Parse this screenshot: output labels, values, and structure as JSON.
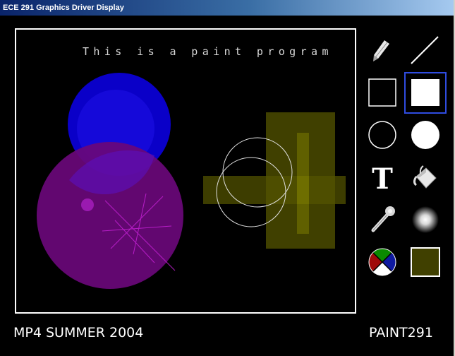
{
  "window": {
    "title": "ECE 291 Graphics Driver Display"
  },
  "canvas": {
    "banner_text": "This is a paint program"
  },
  "toolbar": {
    "tools": [
      {
        "name": "pencil-tool",
        "icon": "pencil-icon"
      },
      {
        "name": "line-tool",
        "icon": "line-icon"
      },
      {
        "name": "rectangle-outline-tool",
        "icon": "rectangle-outline-icon"
      },
      {
        "name": "rectangle-filled-tool",
        "icon": "rectangle-filled-icon",
        "selected": true
      },
      {
        "name": "circle-outline-tool",
        "icon": "circle-outline-icon"
      },
      {
        "name": "circle-filled-tool",
        "icon": "circle-filled-icon"
      },
      {
        "name": "text-tool",
        "icon": "text-icon",
        "glyph": "T"
      },
      {
        "name": "fill-bucket-tool",
        "icon": "paint-bucket-icon"
      },
      {
        "name": "eyedropper-tool",
        "icon": "eyedropper-icon"
      },
      {
        "name": "airbrush-tool",
        "icon": "airbrush-icon"
      },
      {
        "name": "color-palette-tool",
        "icon": "color-wheel-icon"
      },
      {
        "name": "current-color-swatch",
        "icon": "color-swatch-icon"
      }
    ],
    "current_color": "#404000"
  },
  "footer": {
    "left_text": "MP4 SUMMER 2004",
    "right_text": "PAINT291"
  }
}
